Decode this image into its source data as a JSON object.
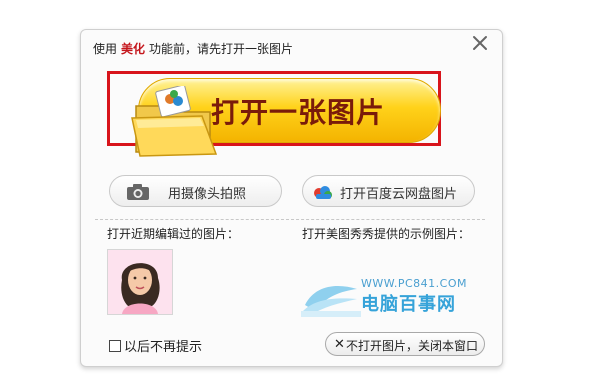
{
  "dialog": {
    "notice_prefix": "使用",
    "notice_accent": "美化",
    "notice_suffix": "功能前，请先打开一张图片",
    "open_button_label": "打开一张图片",
    "camera_button_label": "用摄像头拍照",
    "cloud_button_label": "打开百度云网盘图片",
    "recent_title": "打开近期编辑过的图片：",
    "sample_title": "打开美图秀秀提供的示例图片：",
    "dont_show_label": "以后不再提示",
    "close_button_label": "不打开图片，关闭本窗口"
  },
  "watermark": {
    "url": "WWW.PC841.COM",
    "name": "电脑百事网"
  },
  "icons": {
    "close": "close-icon",
    "folder": "folder-icon",
    "camera": "camera-icon",
    "cloud": "baidu-cloud-icon"
  },
  "colors": {
    "accent_red": "#c4161c",
    "highlight_border": "#d8141b",
    "button_yellow": "#ffd21a",
    "button_text": "#7a1b0a",
    "watermark_blue": "#36a3d9"
  }
}
